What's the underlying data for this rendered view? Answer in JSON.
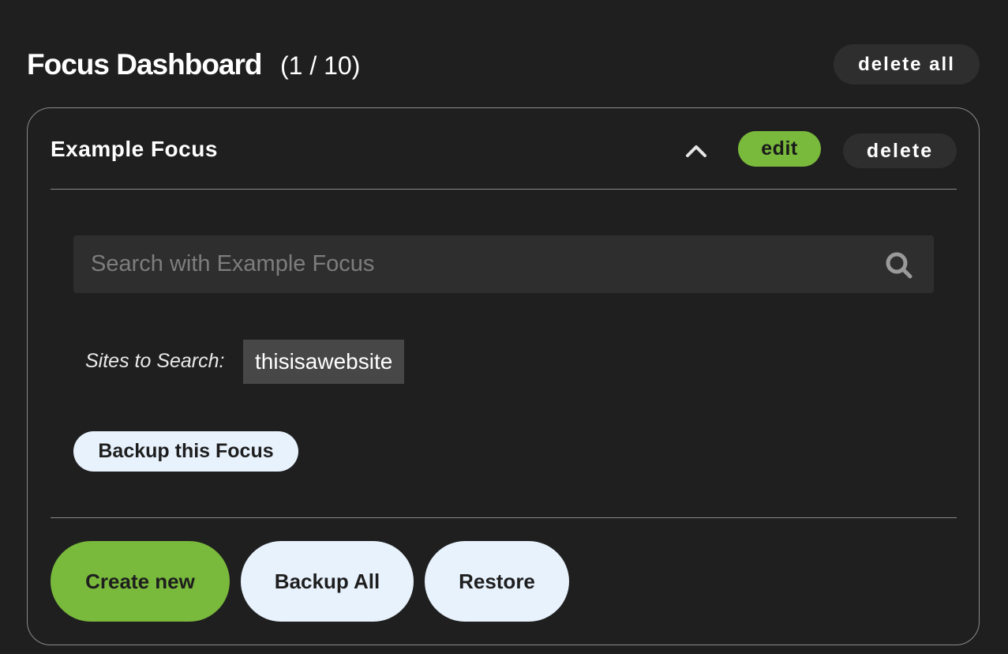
{
  "header": {
    "title": "Focus Dashboard",
    "count": "(1 / 10)",
    "delete_all_label": "delete all"
  },
  "focus": {
    "name": "Example Focus",
    "edit_label": "edit",
    "delete_label": "delete",
    "collapse_icon": "chevron-up-icon",
    "search": {
      "placeholder": "Search with Example Focus",
      "value": "",
      "icon": "search-icon"
    },
    "sites_label": "Sites to Search:",
    "sites": [
      "thisisawebsite"
    ],
    "backup_label": "Backup this Focus"
  },
  "footer": {
    "create_new_label": "Create new",
    "backup_all_label": "Backup All",
    "restore_label": "Restore"
  },
  "colors": {
    "background": "#1f1f1f",
    "accent_green": "#79b93c",
    "light_button": "#e8f2fd",
    "dark_button": "#2e2e2e",
    "border": "#8a8a8a"
  }
}
